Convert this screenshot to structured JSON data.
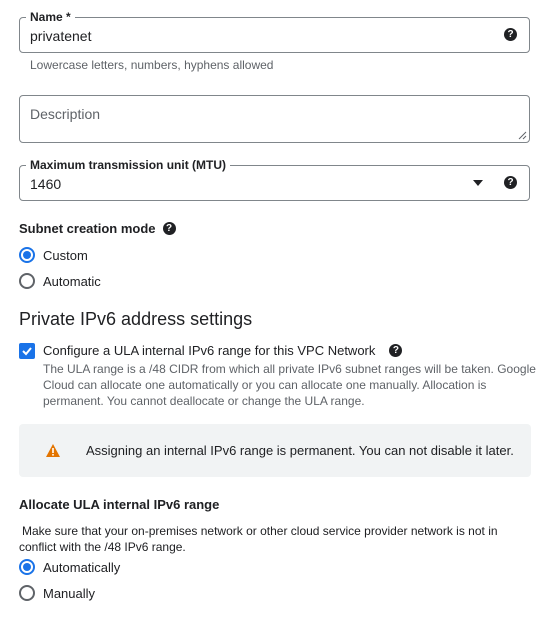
{
  "name_field": {
    "label": "Name *",
    "value": "privatenet",
    "hint": "Lowercase letters, numbers, hyphens allowed"
  },
  "description_field": {
    "placeholder": "Description"
  },
  "mtu_field": {
    "label": "Maximum transmission unit (MTU)",
    "value": "1460"
  },
  "subnet_mode": {
    "label": "Subnet creation mode",
    "options": [
      "Custom",
      "Automatic"
    ],
    "selected": "Custom"
  },
  "ipv6": {
    "heading": "Private IPv6 address settings",
    "checkbox_label": "Configure a ULA internal IPv6 range for this VPC Network",
    "checked": true,
    "desc_lines": [
      "The ULA range is a /48 CIDR from which all private IPv6 subnet ranges will be taken. Google",
      "Cloud can allocate one automatically or you can allocate one manually. Allocation is",
      "permanent. You cannot deallocate or change the ULA range."
    ]
  },
  "warning": {
    "text": "Assigning an internal IPv6 range is permanent. You can not disable it later.",
    "color": "#e37400"
  },
  "allocate": {
    "label": "Allocate ULA internal IPv6 range",
    "desc_lines": [
      "Make sure that your on-premises network or other cloud service provider network is not in",
      "conflict with the /48 IPv6 range."
    ],
    "options": [
      "Automatically",
      "Manually"
    ],
    "selected": "Automatically"
  },
  "icons": {
    "help": "help-circle-icon",
    "dropdown": "arrow-drop-down-icon",
    "warning": "warning-triangle-icon",
    "check": "check-icon"
  },
  "colors": {
    "accent": "#1a73e8",
    "text": "#202124",
    "secondary": "#5f6368",
    "banner_bg": "#f1f3f4"
  }
}
